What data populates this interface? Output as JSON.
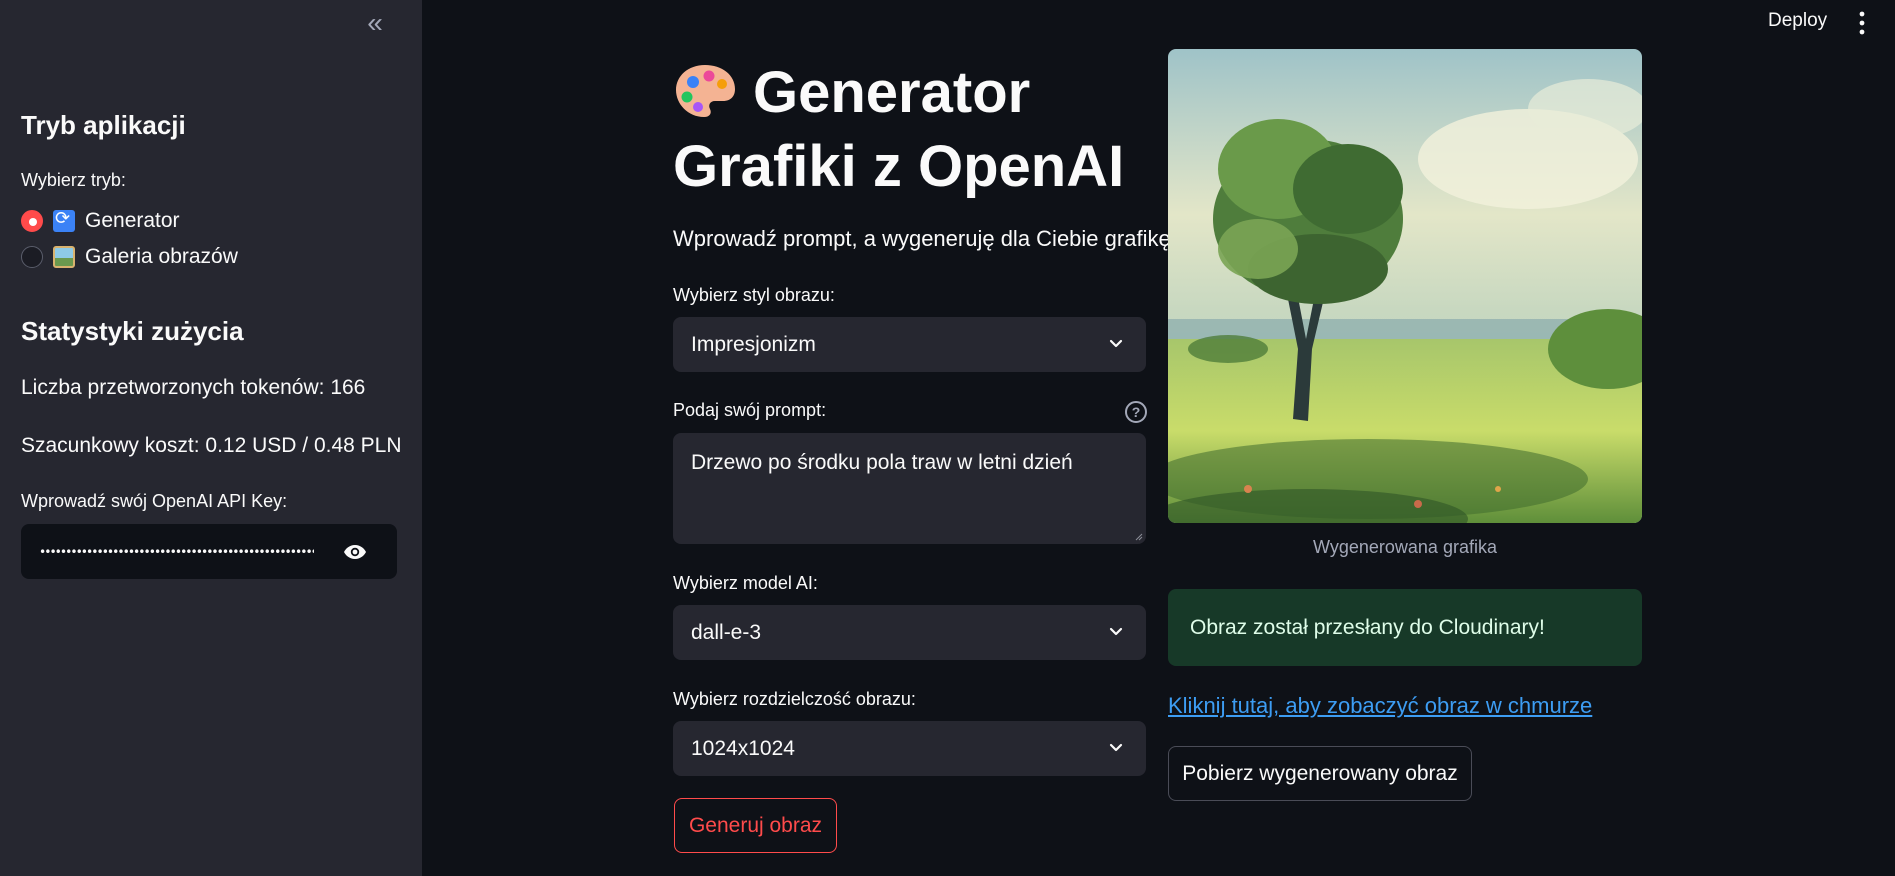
{
  "topbar": {
    "deploy_label": "Deploy"
  },
  "sidebar": {
    "mode_heading": "Tryb aplikacji",
    "mode_label": "Wybierz tryb:",
    "modes": [
      {
        "label": "Generator",
        "selected": true
      },
      {
        "label": "Galeria obrazów",
        "selected": false
      }
    ],
    "stats_heading": "Statystyki zużycia",
    "tokens_text": "Liczba przetworzonych tokenów: 166",
    "cost_text": "Szacunkowy koszt: 0.12 USD / 0.48 PLN",
    "api_key_label": "Wprowadź swój OpenAI API Key:",
    "api_key_masked": "••••••••••••••••••••••••••••••••••••••••••••••••••••••••"
  },
  "main": {
    "title": "Generator Grafiki z OpenAI",
    "subtitle": "Wprowadź prompt, a wygeneruję dla Ciebie grafikę!",
    "style_label": "Wybierz styl obrazu:",
    "style_value": "Impresjonizm",
    "prompt_label": "Podaj swój prompt:",
    "prompt_help": "?",
    "prompt_value": "Drzewo po środku pola traw w letni dzień",
    "model_label": "Wybierz model AI:",
    "model_value": "dall-e-3",
    "resolution_label": "Wybierz rozdzielczość obrazu:",
    "resolution_value": "1024x1024",
    "generate_button": "Generuj obraz"
  },
  "result": {
    "image_caption": "Wygenerowana grafika",
    "success_message": "Obraz został przesłany do Cloudinary!",
    "cloud_link": "Kliknij tutaj, aby zobaczyć obraz w chmurze",
    "download_button": "Pobierz wygenerowany obraz"
  },
  "colors": {
    "background": "#0e1117",
    "sidebar": "#262730",
    "primary": "#ff4b4b",
    "success_bg": "#173928",
    "link": "#3d9df3"
  }
}
